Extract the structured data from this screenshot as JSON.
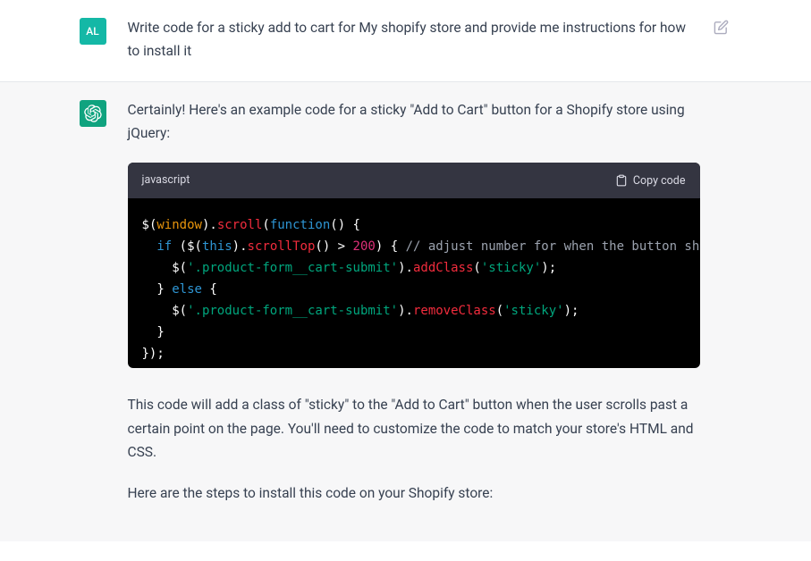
{
  "user": {
    "avatar_initials": "AL",
    "message": "Write code for a sticky add to cart for My shopify store and provide me instructions for how to install it"
  },
  "assistant": {
    "intro": "Certainly! Here's an example code for a sticky \"Add to Cart\" button for a Shopify store using jQuery:",
    "explanation": "This code will add a class of \"sticky\" to the \"Add to Cart\" button when the user scrolls past a certain point on the page. You'll need to customize the code to match your store's HTML and CSS.",
    "install_intro": "Here are the steps to install this code on your Shopify store:"
  },
  "code": {
    "language_label": "javascript",
    "copy_label": "Copy code",
    "tokens": [
      [
        {
          "c": "var",
          "t": "$"
        },
        {
          "c": "punct",
          "t": "("
        },
        {
          "c": "builtin",
          "t": "window"
        },
        {
          "c": "punct",
          "t": ")."
        },
        {
          "c": "func",
          "t": "scroll"
        },
        {
          "c": "punct",
          "t": "("
        },
        {
          "c": "kw",
          "t": "function"
        },
        {
          "c": "punct",
          "t": "() {"
        }
      ],
      [
        {
          "c": "punct",
          "t": "  "
        },
        {
          "c": "kw",
          "t": "if"
        },
        {
          "c": "punct",
          "t": " ("
        },
        {
          "c": "var",
          "t": "$"
        },
        {
          "c": "punct",
          "t": "("
        },
        {
          "c": "kw",
          "t": "this"
        },
        {
          "c": "punct",
          "t": ")."
        },
        {
          "c": "func",
          "t": "scrollTop"
        },
        {
          "c": "punct",
          "t": "() > "
        },
        {
          "c": "num",
          "t": "200"
        },
        {
          "c": "punct",
          "t": ") { "
        },
        {
          "c": "comment",
          "t": "// adjust number for when the button should become sticky"
        }
      ],
      [
        {
          "c": "punct",
          "t": "    "
        },
        {
          "c": "var",
          "t": "$"
        },
        {
          "c": "punct",
          "t": "("
        },
        {
          "c": "str",
          "t": "'.product-form__cart-submit'"
        },
        {
          "c": "punct",
          "t": ")."
        },
        {
          "c": "func",
          "t": "addClass"
        },
        {
          "c": "punct",
          "t": "("
        },
        {
          "c": "str",
          "t": "'sticky'"
        },
        {
          "c": "punct",
          "t": ");"
        }
      ],
      [
        {
          "c": "punct",
          "t": "  } "
        },
        {
          "c": "kw",
          "t": "else"
        },
        {
          "c": "punct",
          "t": " {"
        }
      ],
      [
        {
          "c": "punct",
          "t": "    "
        },
        {
          "c": "var",
          "t": "$"
        },
        {
          "c": "punct",
          "t": "("
        },
        {
          "c": "str",
          "t": "'.product-form__cart-submit'"
        },
        {
          "c": "punct",
          "t": ")."
        },
        {
          "c": "func",
          "t": "removeClass"
        },
        {
          "c": "punct",
          "t": "("
        },
        {
          "c": "str",
          "t": "'sticky'"
        },
        {
          "c": "punct",
          "t": ");"
        }
      ],
      [
        {
          "c": "punct",
          "t": "  }"
        }
      ],
      [
        {
          "c": "punct",
          "t": "});"
        }
      ]
    ]
  }
}
